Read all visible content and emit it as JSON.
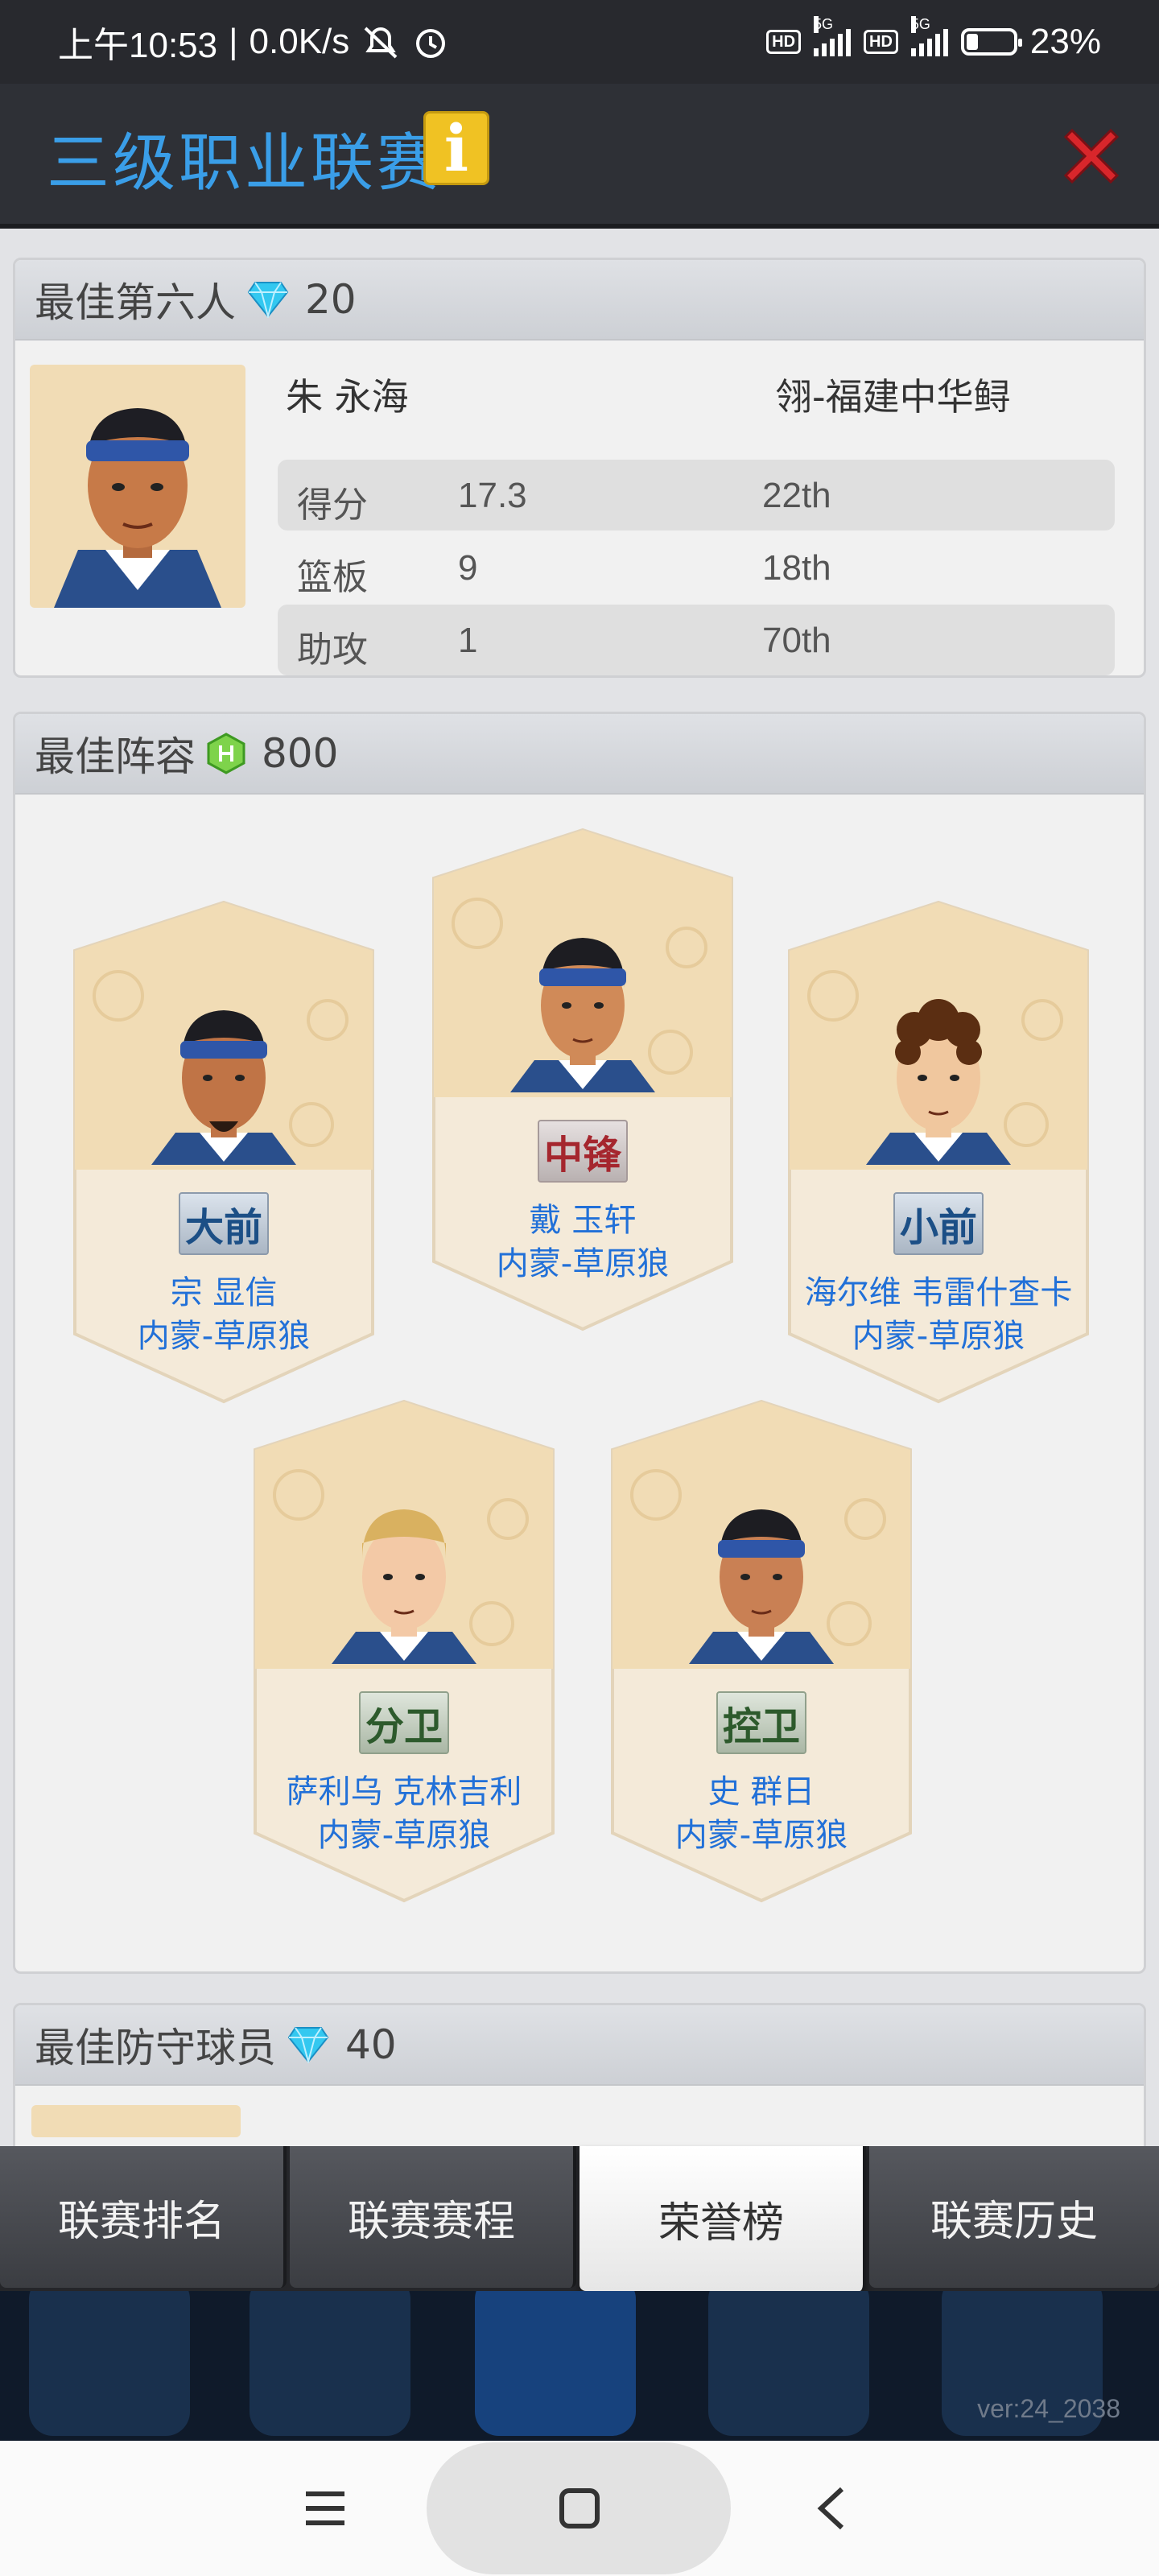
{
  "status_bar": {
    "time": "上午10:53",
    "speed": "0.0K/s",
    "battery": "23%",
    "battery_level": 0.23,
    "network_label": "5G",
    "hd_label": "HD"
  },
  "header": {
    "title": "三级职业联赛",
    "info_label": "i",
    "icons": [
      "info-icon",
      "close-icon"
    ]
  },
  "sixth_man": {
    "title": "最佳第六人",
    "reward_icon": "diamond-icon",
    "reward": "20",
    "player": "朱 永海",
    "team": "翎-福建中华鲟",
    "stats": [
      {
        "label": "得分",
        "value": "17.3",
        "rank": "22th"
      },
      {
        "label": "篮板",
        "value": "9",
        "rank": "18th"
      },
      {
        "label": "助攻",
        "value": "1",
        "rank": "70th"
      }
    ]
  },
  "lineup": {
    "title": "最佳阵容",
    "reward_icon": "hex-coin-icon",
    "reward": "800",
    "players": [
      {
        "position": "大前",
        "name": "宗 显信",
        "team": "内蒙-草原狼"
      },
      {
        "position": "中锋",
        "name": "戴 玉轩",
        "team": "内蒙-草原狼"
      },
      {
        "position": "小前",
        "name": "海尔维 韦雷什查卡",
        "team": "内蒙-草原狼"
      },
      {
        "position": "分卫",
        "name": "萨利乌 克林吉利",
        "team": "内蒙-草原狼"
      },
      {
        "position": "控卫",
        "name": "史 群日",
        "team": "内蒙-草原狼"
      }
    ]
  },
  "defense": {
    "title": "最佳防守球员",
    "reward_icon": "diamond-icon",
    "reward": "40"
  },
  "tabs": [
    "联赛排名",
    "联赛赛程",
    "荣誉榜",
    "联赛历史"
  ],
  "active_tab": "荣誉榜",
  "version": "ver:24_2038",
  "colors": {
    "title_blue": "#3a9ee8",
    "name_blue": "#2170d8",
    "close_red": "#d8262b",
    "info_yellow": "#f0c223"
  }
}
